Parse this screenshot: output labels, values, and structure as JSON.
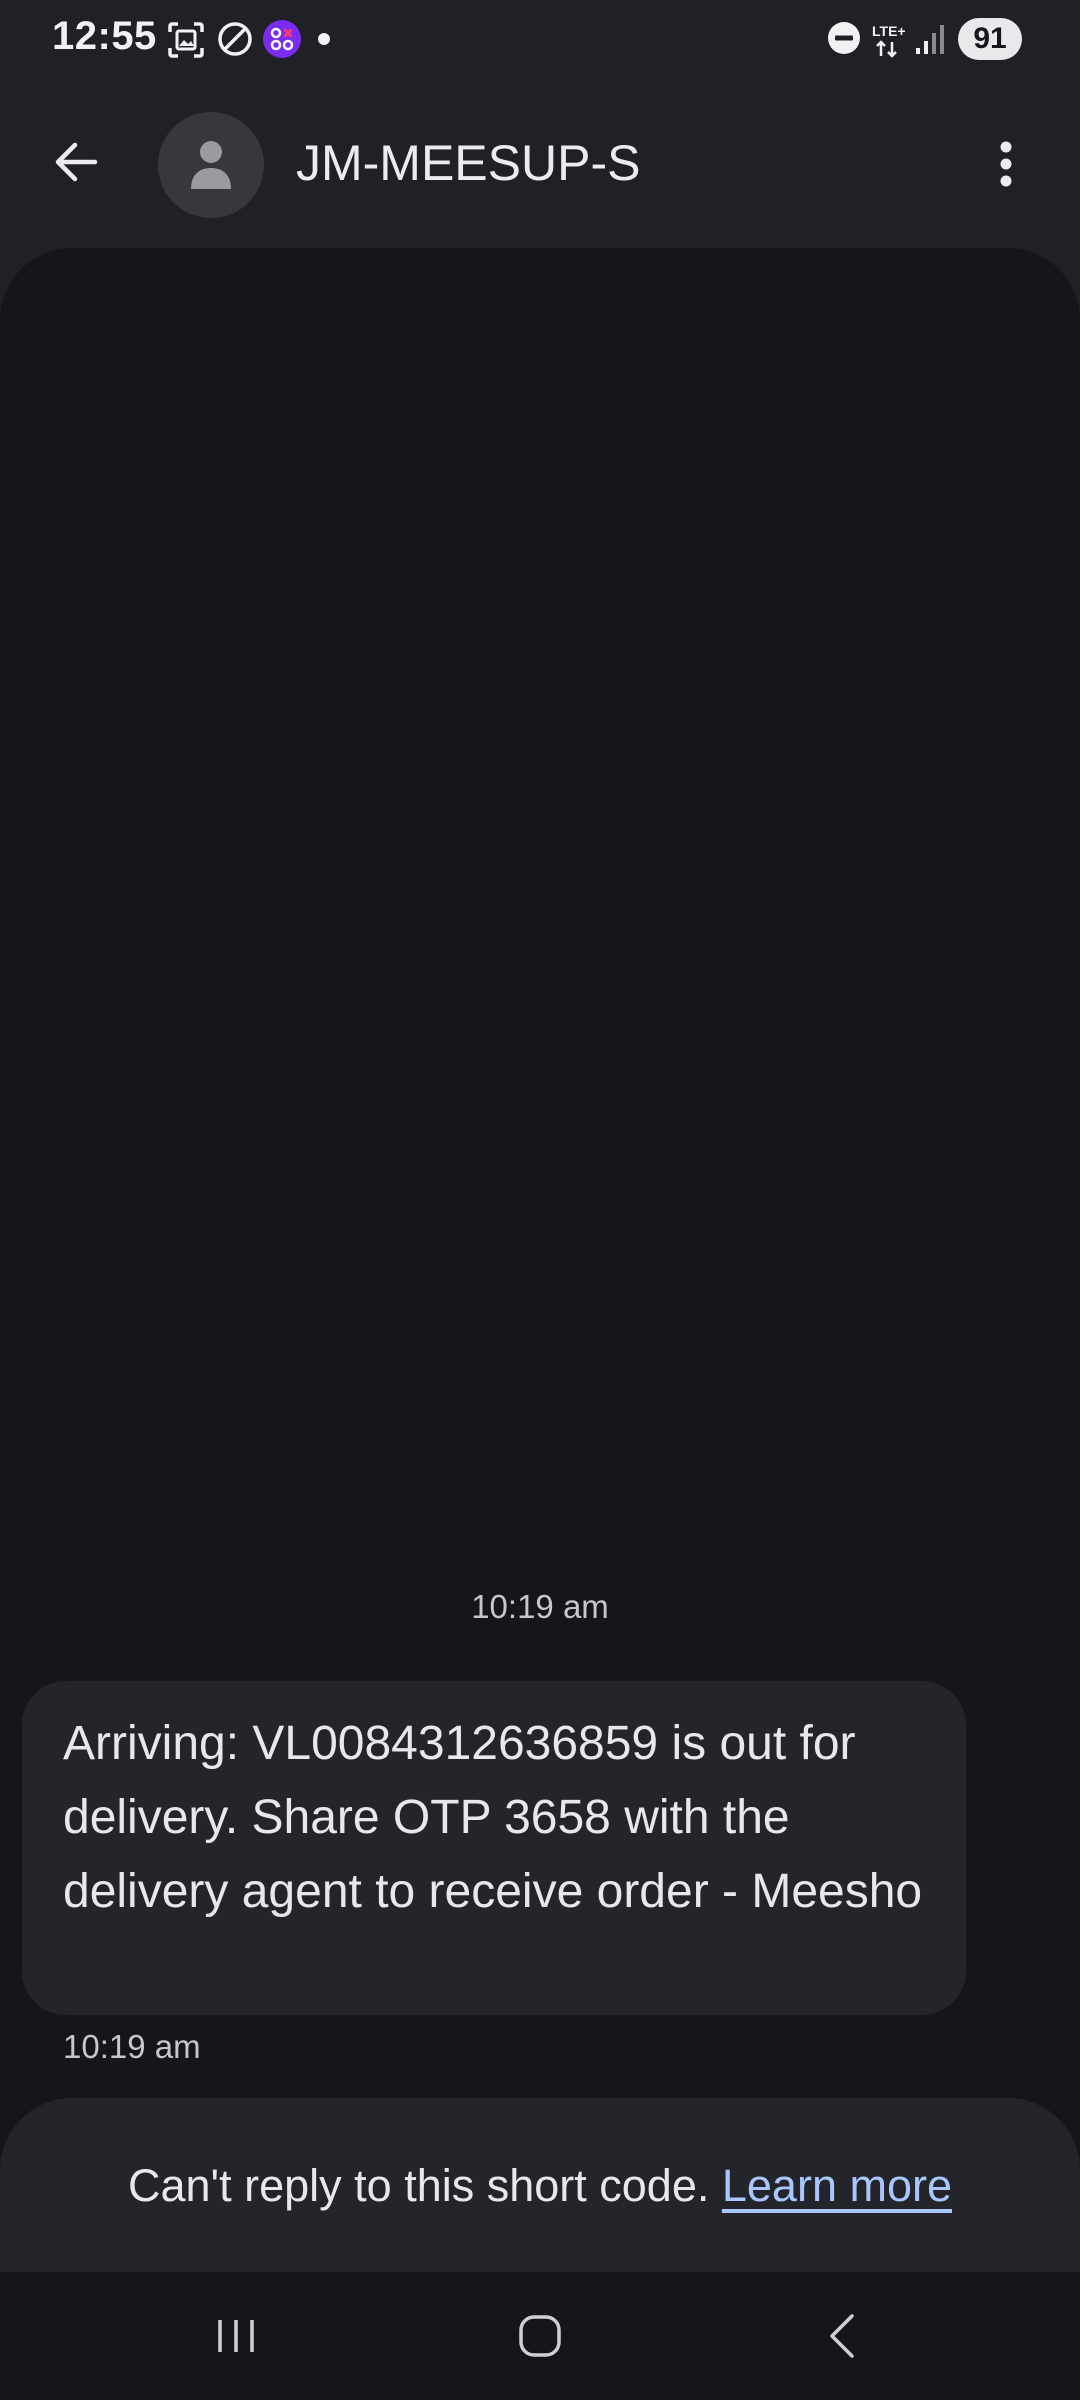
{
  "status_bar": {
    "time": "12:55",
    "battery": "91",
    "network": "LTE+",
    "icons": [
      "screenshot-icon",
      "dnd-off-icon",
      "app-notification-icon",
      "dot-icon",
      "do-not-disturb-icon",
      "lte-icon",
      "signal-icon",
      "battery-icon"
    ]
  },
  "app_bar": {
    "contact_name": "JM-MEESUP-S",
    "back_icon": "arrow-back-icon",
    "avatar_icon": "person-icon",
    "menu_icon": "more-vert-icon"
  },
  "conversation": {
    "header_timestamp": "10:19 am",
    "messages": [
      {
        "text": "Arriving: VL0084312636859 is out for delivery. Share OTP 3658 with the delivery agent to receive order - Meesho",
        "time": "10:19 am"
      }
    ]
  },
  "footer": {
    "notice": "Can't reply to this short code.",
    "link": "Learn more"
  },
  "nav_bar": {
    "icons": [
      "recents-icon",
      "home-icon",
      "back-icon"
    ]
  },
  "colors": {
    "background": "#202126",
    "conversation_bg": "#15161a",
    "bubble_bg": "#24252b",
    "link": "#a9c7ff",
    "text": "#e8e8ec"
  }
}
